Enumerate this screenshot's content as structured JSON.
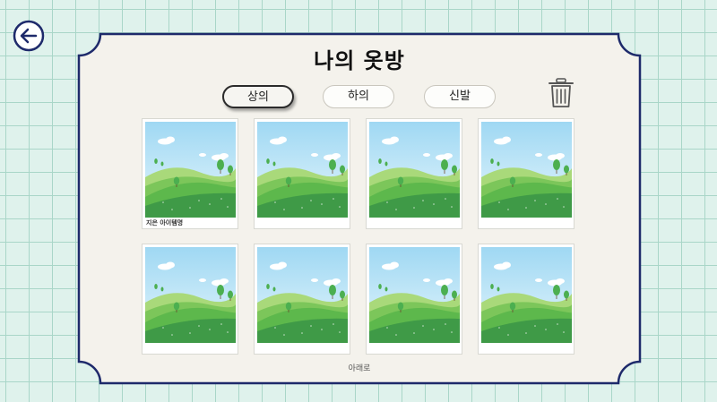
{
  "page": {
    "title": "나의 옷방",
    "tabs": [
      {
        "label": "상의",
        "active": true
      },
      {
        "label": "하의",
        "active": false
      },
      {
        "label": "신발",
        "active": false
      }
    ],
    "items": [
      {
        "label": "지은 아이템명"
      },
      {
        "label": ""
      },
      {
        "label": ""
      },
      {
        "label": ""
      },
      {
        "label": ""
      },
      {
        "label": ""
      },
      {
        "label": ""
      },
      {
        "label": ""
      }
    ],
    "scroll_down_label": "아래로"
  },
  "icons": {
    "back": "arrow-left-circle-icon",
    "trash": "trash-icon",
    "thumbnail": "landscape-placeholder-image"
  },
  "colors": {
    "frame_stroke": "#1e2a6b",
    "panel_fill": "#f4f2ec",
    "background": "#dff2ec",
    "grid": "#a9d6c8"
  }
}
